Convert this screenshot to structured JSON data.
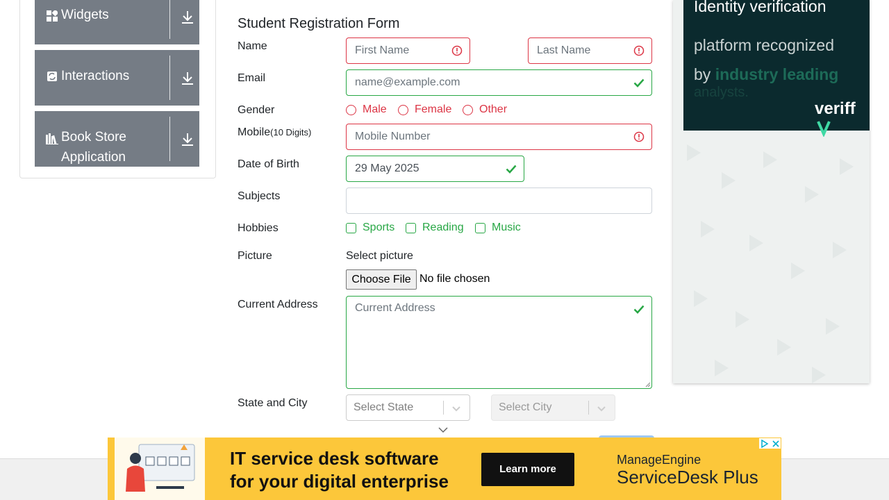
{
  "sidebar": {
    "groups": [
      {
        "label": "Widgets",
        "icon": "widgets-icon"
      },
      {
        "label": "Interactions",
        "icon": "interactions-icon"
      },
      {
        "label": "Book Store Application",
        "label_line1": "Book Store",
        "label_line2": "Application",
        "icon": "books-icon"
      }
    ]
  },
  "form": {
    "title": "Student Registration Form",
    "name_label": "Name",
    "first_name_placeholder": "First Name",
    "last_name_placeholder": "Last Name",
    "email_label": "Email",
    "email_placeholder": "name@example.com",
    "gender_label": "Gender",
    "genders": [
      "Male",
      "Female",
      "Other"
    ],
    "mobile_label": "Mobile",
    "mobile_hint": "(10 Digits)",
    "mobile_placeholder": "Mobile Number",
    "dob_label": "Date of Birth",
    "dob_value": "29 May 2025",
    "subjects_label": "Subjects",
    "hobbies_label": "Hobbies",
    "hobbies": [
      "Sports",
      "Reading",
      "Music"
    ],
    "picture_label": "Picture",
    "picture_caption": "Select picture",
    "choose_file_label": "Choose File",
    "no_file_text": "No file chosen",
    "address_label": "Current Address",
    "address_placeholder": "Current Address",
    "state_city_label": "State and City",
    "state_placeholder": "Select State",
    "city_placeholder": "Select City"
  },
  "side_ad": {
    "line1": "Identity verification",
    "line2": "platform recognized",
    "line3_prefix": "by ",
    "line3_bold": "industry leading",
    "line4": "analysts.",
    "brand": "veriff"
  },
  "bottom_ad": {
    "headline1": "IT service desk software",
    "headline2": "for your digital enterprise",
    "cta": "Learn more",
    "brand1": "ManageEngine",
    "brand2": "ServiceDesk Plus"
  },
  "colors": {
    "invalid": "#dc3545",
    "valid": "#28a745",
    "sidebar_group_bg": "#757c85",
    "ad_yellow": "#fcc73a",
    "ad_dark": "#0b2a2e"
  }
}
